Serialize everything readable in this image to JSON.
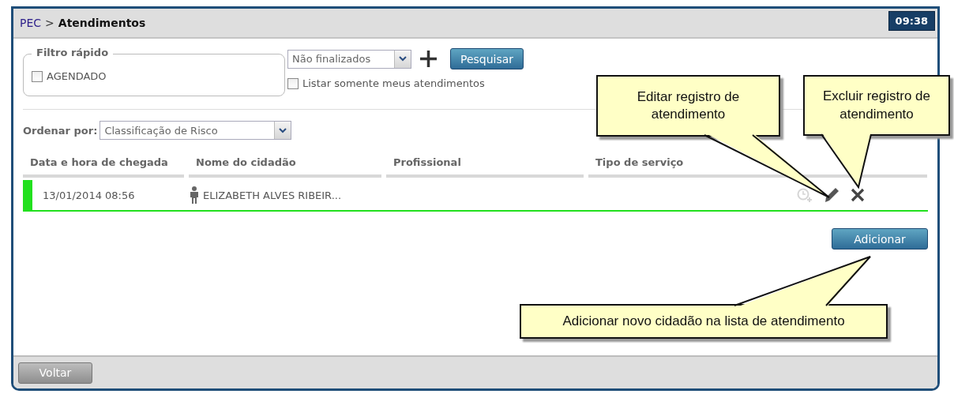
{
  "breadcrumb": {
    "root": "PEC",
    "separator": ">",
    "current": "Atendimentos"
  },
  "clock": "09:38",
  "quick_filter": {
    "legend": "Filtro rápido",
    "options": [
      {
        "label": "AGENDADO",
        "checked": false
      }
    ]
  },
  "status_select": {
    "value": "Não finalizados"
  },
  "search_button": "Pesquisar",
  "only_mine": {
    "label": "Listar somente meus atendimentos",
    "checked": false
  },
  "sort": {
    "label": "Ordenar por:",
    "value": "Classificação de Risco"
  },
  "table": {
    "columns": [
      "Data e hora de chegada",
      "Nome do cidadão",
      "Profissional",
      "Tipo de serviço"
    ],
    "rows": [
      {
        "arrival": "13/01/2014 08:56",
        "citizen": "ELIZABETH ALVES RIBEIR...",
        "color": "#22e01e",
        "schedule_disabled": true
      }
    ]
  },
  "add_button": "Adicionar",
  "back_button": "Voltar",
  "callouts": [
    {
      "text": "Editar registro de atendimento"
    },
    {
      "text": "Excluir registro de atendimento"
    },
    {
      "text": "Adicionar novo cidadão na lista de atendimento"
    }
  ]
}
